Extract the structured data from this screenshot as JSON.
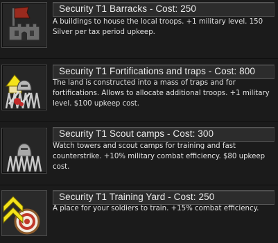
{
  "buildings": [
    {
      "title": "Security T1 Barracks - Cost: 250",
      "description": "A buildings to house the local troops. +1 military level. 150 Silver per tax period upkeep.",
      "icon": "barracks-icon"
    },
    {
      "title": "Security T1 Fortifications and traps - Cost: 800",
      "description": "The land is constructed into a mass of traps and for fortifications. Allows to allocate additional troops. +1 military level. $100 upkeep cost.",
      "icon": "fortifications-icon"
    },
    {
      "title": "Security T1 Scout camps - Cost: 300",
      "description": "Watch towers and scout camps for training and fast counterstrike. +10% military combat efficiency. $80 upkeep cost.",
      "icon": "scout-camps-icon"
    },
    {
      "title": "Security T1 Training Yard - Cost: 250",
      "description": "A place for your soldiers to train. +15% combat efficiency.",
      "icon": "training-yard-icon"
    }
  ],
  "colors": {
    "background": "#1b1b1b",
    "title_bar": "#2c2c2c",
    "text": "#ececec",
    "flag_red": "#9a2a1e",
    "sword_yellow": "#f3e21a",
    "target_red": "#c0392b"
  }
}
